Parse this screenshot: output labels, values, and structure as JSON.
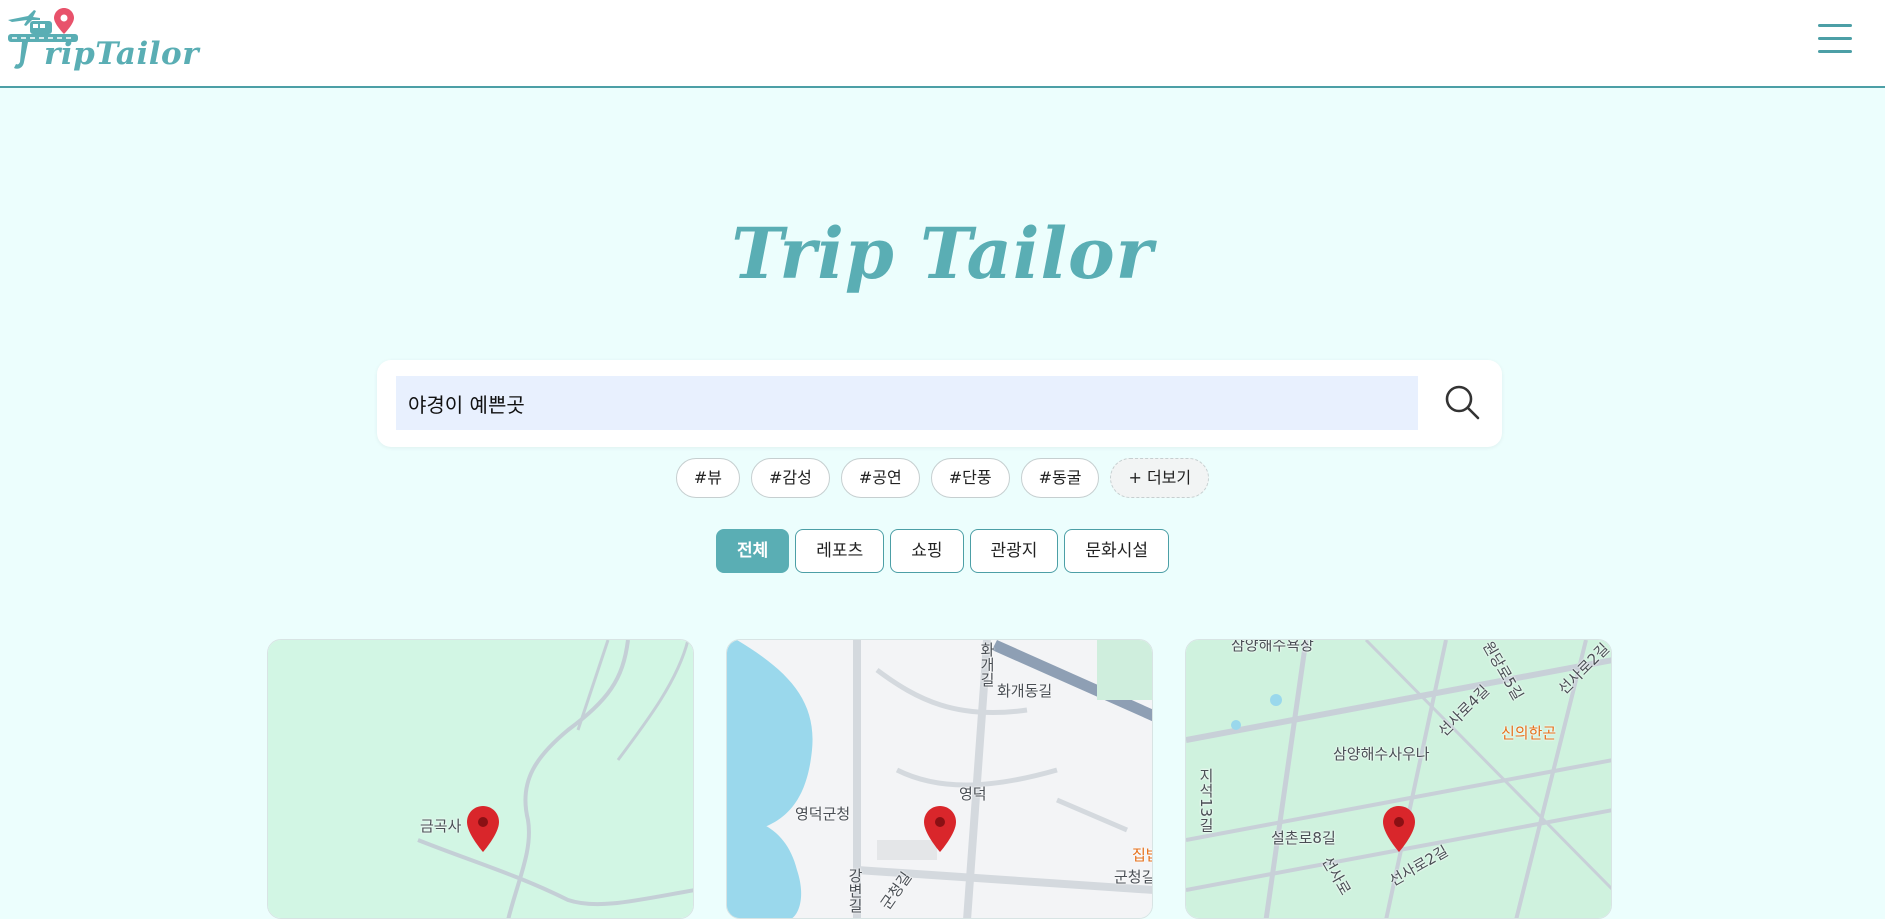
{
  "header": {
    "logo_text": "ripTailor",
    "menu_icon": "hamburger-menu-icon"
  },
  "hero": {
    "title": "Trip Tailor"
  },
  "search": {
    "value": "야경이 예쁜곳",
    "icon": "search-icon"
  },
  "tags": [
    "#뷰",
    "#감성",
    "#공연",
    "#단풍",
    "#동굴",
    "+ 더보기"
  ],
  "categories": [
    "전체",
    "레포츠",
    "쇼핑",
    "관광지",
    "문화시설"
  ],
  "active_category": "전체",
  "cards": [
    {
      "map_labels": [
        "금곡사"
      ]
    },
    {
      "map_labels": [
        "화개동길",
        "영덕군청",
        "영덕",
        "강변길",
        "군청길",
        "군청길",
        "집밥",
        "화개길"
      ]
    },
    {
      "map_labels": [
        "삼양해수욕장",
        "신의한곤",
        "삼양해수사우나",
        "선사로4길",
        "원당로5길",
        "선사로2길",
        "지석13길",
        "설촌로8길",
        "선사로2길",
        "선사로"
      ]
    }
  ],
  "colors": {
    "brand": "#5aaeb4",
    "background": "#ecfefd",
    "pin": "#d9262b"
  }
}
